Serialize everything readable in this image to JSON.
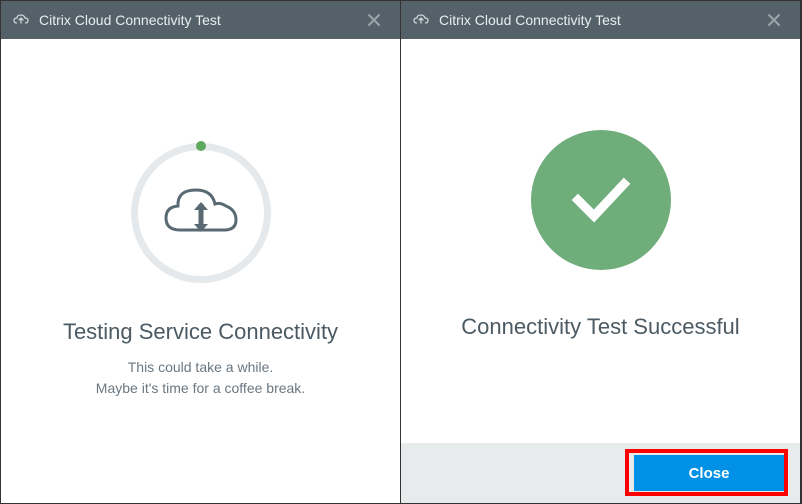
{
  "left": {
    "titlebar": {
      "title": "Citrix Cloud Connectivity Test"
    },
    "status": {
      "heading": "Testing Service Connectivity",
      "line1": "This could take a while.",
      "line2": "Maybe it's time for a coffee break."
    }
  },
  "right": {
    "titlebar": {
      "title": "Citrix Cloud Connectivity Test"
    },
    "status": {
      "heading": "Connectivity Test Successful"
    },
    "footer": {
      "close_label": "Close"
    }
  },
  "colors": {
    "accent": "#0091e6",
    "success": "#6fae7b",
    "titlebar": "#546169"
  }
}
